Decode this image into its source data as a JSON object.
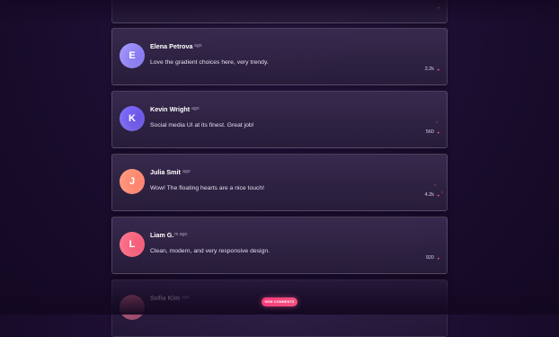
{
  "comments": [
    {
      "initial": "E",
      "name": "Elena Petrova",
      "time": "ago",
      "text": "Love the gradient choices here, very trendy.",
      "likes": "3.2k",
      "avatar_color": "#8b7bf0"
    },
    {
      "initial": "K",
      "name": "Kevin Wright",
      "time": "ago",
      "text": "Social media UI at its finest. Great job!",
      "likes": "560",
      "avatar_color": "#6654e6"
    },
    {
      "initial": "J",
      "name": "Julia Smit",
      "time": "ago",
      "text": "Wow! The floating hearts are a nice touch!",
      "likes": "4.2k",
      "avatar_color": "#ff8a6a"
    },
    {
      "initial": "L",
      "name": "Liam G.",
      "time": "m ago",
      "text": "Clean, modern, and very responsive design.",
      "likes": "920",
      "avatar_color": "#ff5a7a"
    },
    {
      "initial": "",
      "name": "Sofia Kim",
      "time": "ago",
      "text": "",
      "likes": "",
      "avatar_color": "#ff6a8b"
    }
  ],
  "new_comments_label": "NEW COMMENTS",
  "accent": "#ff4f8b",
  "icons": {
    "like": "heart-icon"
  }
}
